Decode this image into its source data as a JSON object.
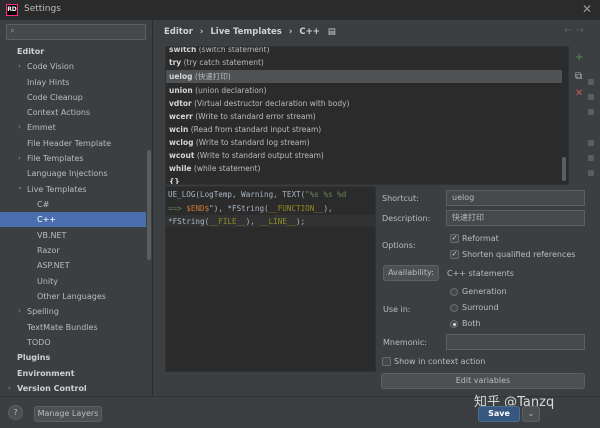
{
  "window": {
    "title": "Settings",
    "app_icon_text": "RD"
  },
  "search": {
    "placeholder": ""
  },
  "tree": {
    "editor": "Editor",
    "code_vision": "Code Vision",
    "inlay_hints": "Inlay Hints",
    "code_cleanup": "Code Cleanup",
    "context_actions": "Context Actions",
    "emmet": "Emmet",
    "file_header_template": "File Header Template",
    "file_templates": "File Templates",
    "language_injections": "Language Injections",
    "live_templates": "Live Templates",
    "csharp": "C#",
    "cpp": "C++",
    "vbnet": "VB.NET",
    "razor": "Razor",
    "aspnet": "ASP.NET",
    "unity": "Unity",
    "other_languages": "Other Languages",
    "spelling": "Spelling",
    "textmate_bundles": "TextMate Bundles",
    "todo": "TODO",
    "plugins": "Plugins",
    "environment": "Environment",
    "version_control": "Version Control"
  },
  "breadcrumb": {
    "part1": "Editor",
    "sep1": "›",
    "part2": "Live Templates",
    "sep2": "›",
    "part3": "C++",
    "icon": "▤"
  },
  "templates": [
    {
      "abbr": "switch",
      "desc": "(switch statement)"
    },
    {
      "abbr": "try",
      "desc": "(try catch statement)"
    },
    {
      "abbr": "uelog",
      "desc": "(快速打印)"
    },
    {
      "abbr": "union",
      "desc": "(union declaration)"
    },
    {
      "abbr": "vdtor",
      "desc": "(Virtual destructor declaration with body)"
    },
    {
      "abbr": "wcerr",
      "desc": "(Write to standard error stream)"
    },
    {
      "abbr": "wcin",
      "desc": "(Read from standard input stream)"
    },
    {
      "abbr": "wclog",
      "desc": "(Write to standard log stream)"
    },
    {
      "abbr": "wcout",
      "desc": "(Write to standard output stream)"
    },
    {
      "abbr": "while",
      "desc": "(while statement)"
    },
    {
      "abbr": "{}",
      "desc": ""
    }
  ],
  "code": {
    "l1a": "UE_LOG(LogTemp, Warning, TEXT(",
    "l1b": "\"%s %s %d",
    "l2a": "==> ",
    "l2b": "$END$",
    "l2c": "\"), *FString(",
    "l2d": "__FUNCTION__",
    "l2e": "),",
    "l3a": "*FString(",
    "l3b": "__FILE__",
    "l3c": "), ",
    "l3d": "__LINE__",
    "l3e": ");"
  },
  "form": {
    "shortcut_label": "Shortcut:",
    "shortcut_value": "uelog",
    "description_label": "Description:",
    "description_value": "快速打印",
    "options_label": "Options:",
    "reformat": "Reformat",
    "shorten": "Shorten qualified references",
    "availability_button": "Availability:",
    "availability_value": "C++ statements",
    "use_in_label": "Use in:",
    "generation": "Generation",
    "surround": "Surround",
    "both": "Both",
    "mnemonic_label": "Mnemonic:",
    "show_in_context": "Show in context action",
    "edit_variables": "Edit variables"
  },
  "footer": {
    "manage_layers": "Manage Layers",
    "save": "Save",
    "help": "?"
  },
  "watermark": "知乎 @Tanzq"
}
